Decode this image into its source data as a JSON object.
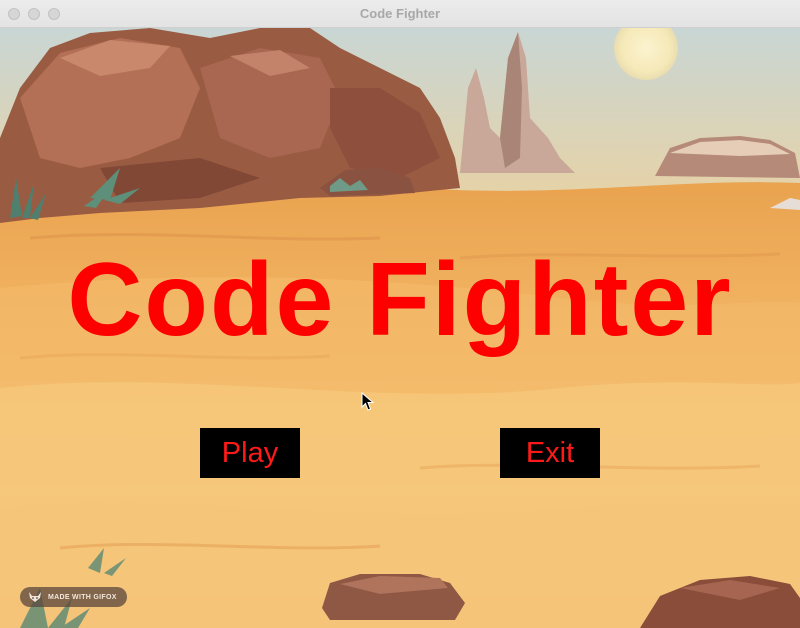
{
  "window": {
    "title": "Code Fighter"
  },
  "game": {
    "title": "Code Fighter",
    "title_color": "#ff0000",
    "buttons": {
      "play_label": "Play",
      "exit_label": "Exit"
    },
    "button_background": "#000000",
    "button_text_color": "#ff1a1a"
  },
  "watermark": {
    "text": "MADE WITH GIFOX",
    "icon": "fox-icon"
  },
  "scene": {
    "background": "desert",
    "sky_color": "#cfd8d2",
    "sand_color": "#f2b766"
  }
}
